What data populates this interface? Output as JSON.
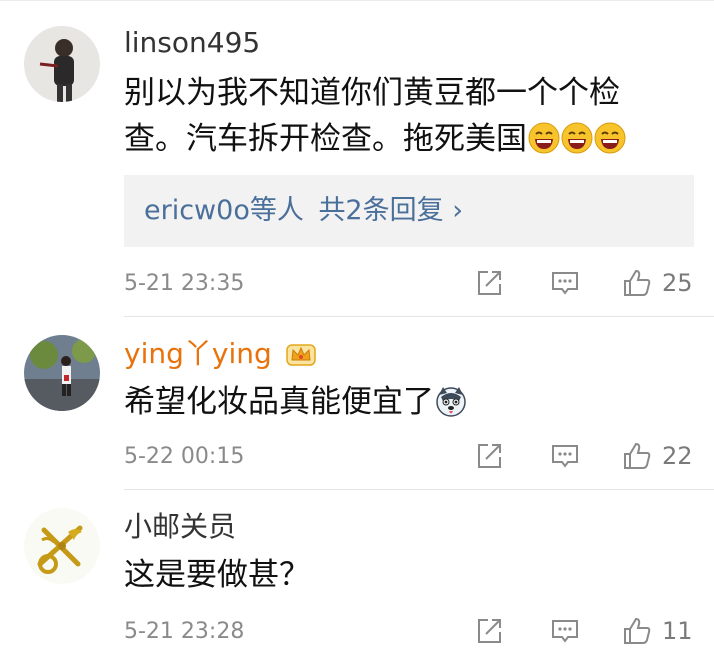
{
  "comments": [
    {
      "username": "linson495",
      "content_lines": [
        "别以为我不知道你们黄豆都一个个检",
        "查。汽车拆开检查。拖死美国"
      ],
      "reply": {
        "users": "ericw0o等人",
        "link": "共2条回复 ›"
      },
      "timestamp": "5-21 23:35",
      "likes": "25",
      "emoji": "laughing-face-icon"
    },
    {
      "username": "ying丫ying",
      "content_lines": [
        "希望化妆品真能便宜了"
      ],
      "timestamp": "5-22 00:15",
      "likes": "22",
      "badge": "crown-icon",
      "emoji": "husky-face-icon"
    },
    {
      "username": "小邮关员",
      "content_lines": [
        "这是要做甚？"
      ],
      "timestamp": "5-21 23:28",
      "likes": "11"
    }
  ],
  "colors": {
    "vip_name": "#e8730c",
    "reply_link": "#4a6f9a",
    "meta_grey": "#8a8a8a"
  }
}
